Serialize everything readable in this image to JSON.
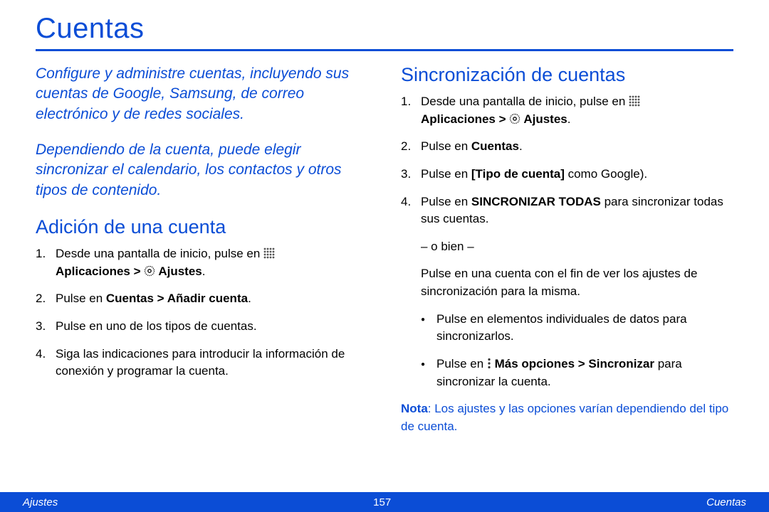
{
  "title": "Cuentas",
  "intro1": "Configure y administre cuentas, incluyendo sus cuentas de Google, Samsung, de correo electrónico y de redes sociales.",
  "intro2": "Dependiendo de la cuenta, puede elegir sincronizar el calendario, los contactos y otros tipos de contenido.",
  "left": {
    "heading": "Adición de una cuenta",
    "step1_a": "Desde una pantalla de inicio, pulse en ",
    "step1_b": "Aplicaciones > ",
    "step1_c": " Ajustes",
    "step1_d": ".",
    "step2_a": "Pulse en ",
    "step2_b": "Cuentas > Añadir cuenta",
    "step2_c": ".",
    "step3": "Pulse en uno de los tipos de cuentas.",
    "step4": "Siga las indicaciones para introducir la información de conexión y programar la cuenta."
  },
  "right": {
    "heading": "Sincronización de cuentas",
    "step1_a": "Desde una pantalla de inicio, pulse en ",
    "step1_b": "Aplicaciones > ",
    "step1_c": " Ajustes",
    "step1_d": ".",
    "step2_a": "Pulse en ",
    "step2_b": "Cuentas",
    "step2_c": ".",
    "step3_a": "Pulse en ",
    "step3_b": "[Tipo de cuenta]",
    "step3_c": " como Google).",
    "step4_a": "Pulse en ",
    "step4_b": "SINCRONIZAR TODAS",
    "step4_c": " para sincronizar todas sus cuentas.",
    "or": "– o bien –",
    "or_text": "Pulse en una cuenta con el fin de ver los ajustes de sincronización para la misma.",
    "bullet1": "Pulse en elementos individuales de datos para sincronizarlos.",
    "bullet2_a": "Pulse en ",
    "bullet2_b": " Más opciones > Sincronizar",
    "bullet2_c": " para sincronizar la cuenta.",
    "note_a": "Nota",
    "note_b": ": Los ajustes y las opciones varían dependiendo del tipo de cuenta."
  },
  "footer": {
    "left": "Ajustes",
    "center": "157",
    "right": "Cuentas"
  }
}
